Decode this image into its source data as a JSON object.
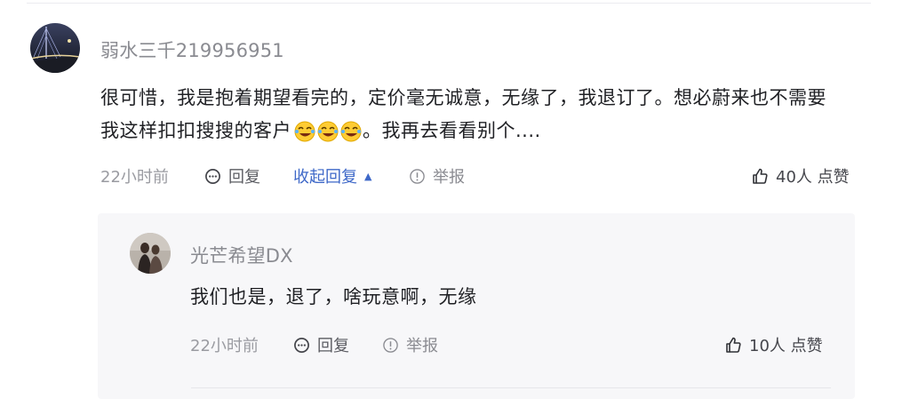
{
  "comment": {
    "username": "弱水三千219956951",
    "text_line1": "很可惜，我是抱着期望看完的，定价毫无诚意，无缘了，我退订了。想必蔚来也不需要",
    "text_line2_pre": "我这样扣扣搜搜的客户",
    "text_emoji_count": 3,
    "text_line2_post": "。我再去看看别个....",
    "time": "22小时前",
    "reply_label": "回复",
    "collapse_label": "收起回复",
    "report_label": "举报",
    "like_label": "40人 点赞"
  },
  "reply": {
    "username": "光芒希望DX",
    "text": "我们也是，退了，啥玩意啊，无缘",
    "time": "22小时前",
    "reply_label": "回复",
    "report_label": "举报",
    "like_label": "10人 点赞"
  },
  "colors": {
    "link": "#3e68c8",
    "muted": "#8a8b91",
    "reply_bg": "#f7f7f9"
  },
  "icons": {
    "reply": "reply-bubble-icon",
    "report": "report-info-icon",
    "like": "thumbs-up-icon",
    "collapse": "triangle-up-icon",
    "emoji": "rofl-emoji-icon"
  }
}
